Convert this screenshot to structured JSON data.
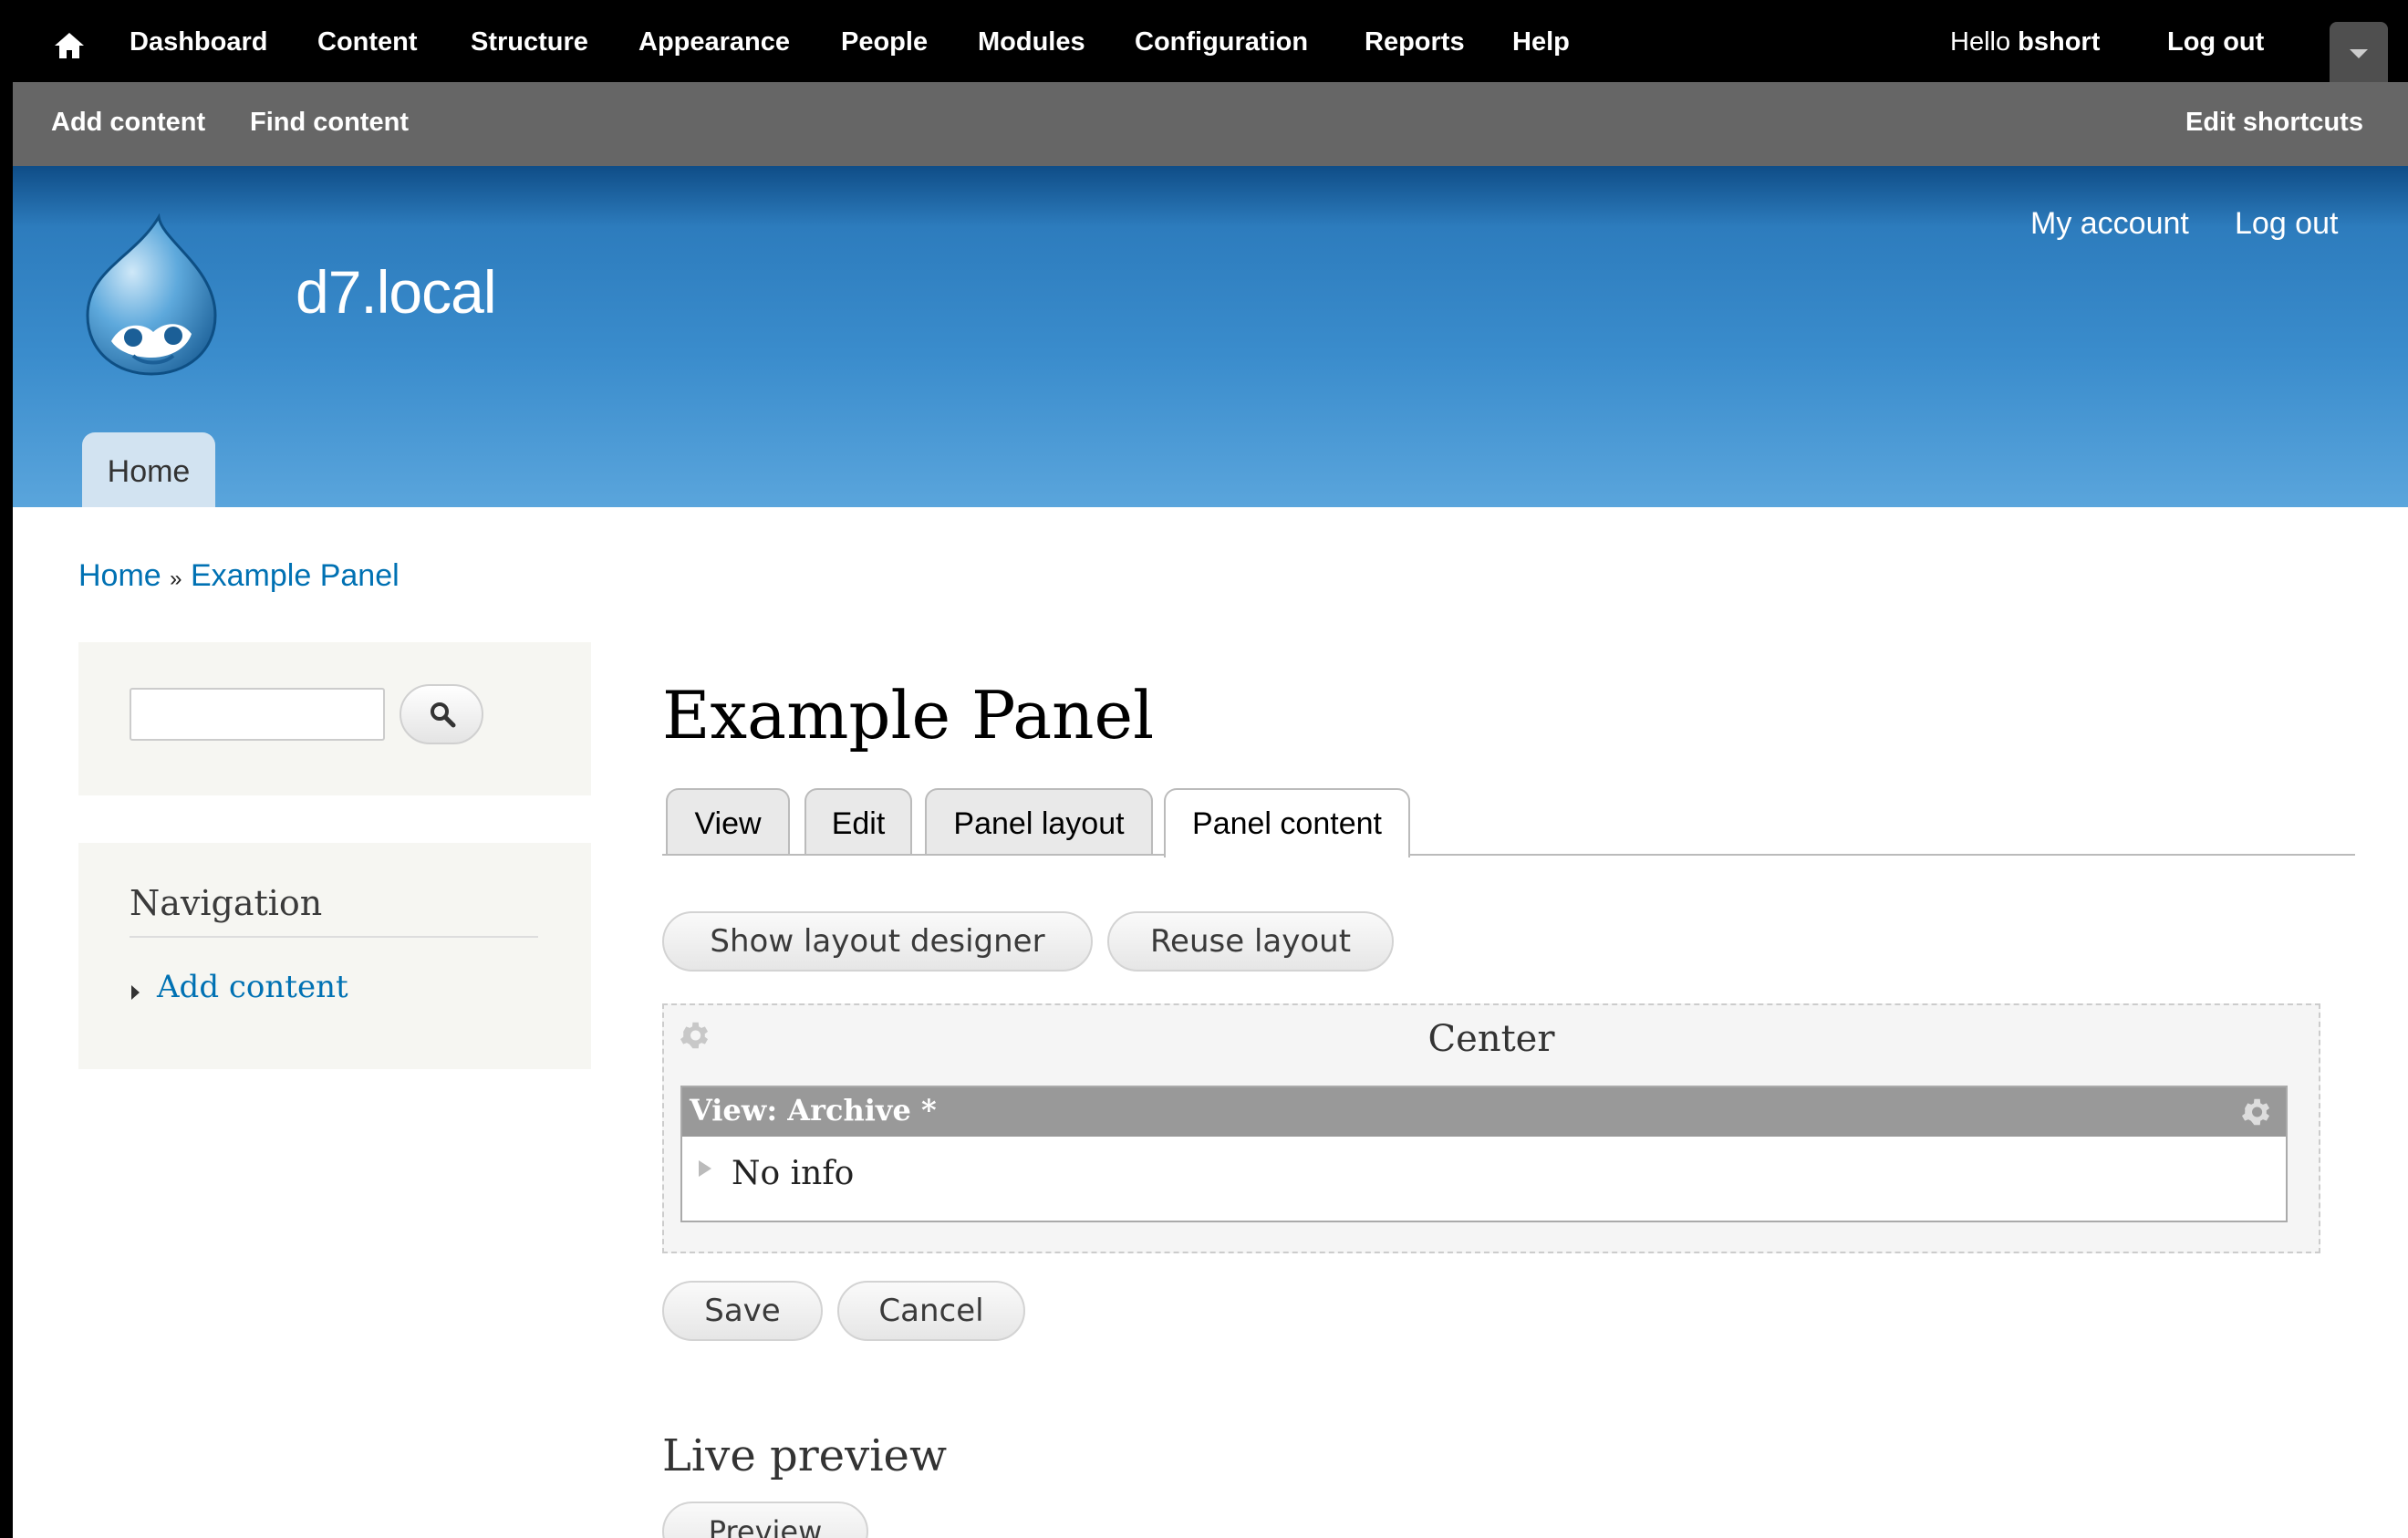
{
  "toolbar": {
    "menu": [
      "Dashboard",
      "Content",
      "Structure",
      "Appearance",
      "People",
      "Modules",
      "Configuration",
      "Reports",
      "Help"
    ],
    "greeting": "Hello",
    "username": "bshort",
    "logout": "Log out"
  },
  "shortcuts": {
    "add_content": "Add content",
    "find_content": "Find content",
    "edit_shortcuts": "Edit shortcuts"
  },
  "header": {
    "site_name": "d7.local",
    "my_account": "My account",
    "logout": "Log out",
    "home_tab": "Home"
  },
  "breadcrumb": {
    "home": "Home",
    "separator": "»",
    "current": "Example Panel"
  },
  "sidebar": {
    "search_value": "",
    "navigation_title": "Navigation",
    "navigation_items": [
      "Add content"
    ]
  },
  "main": {
    "title": "Example Panel",
    "tabs": [
      "View",
      "Edit",
      "Panel layout",
      "Panel content"
    ],
    "active_tab": "Panel content",
    "show_layout_designer": "Show layout designer",
    "reuse_layout": "Reuse layout",
    "region_title": "Center",
    "pane_title": "View: Archive *",
    "pane_info": "No info",
    "save": "Save",
    "cancel": "Cancel",
    "live_preview_title": "Live preview",
    "preview_button": "Preview"
  },
  "colors": {
    "toolbar_bg": "#000000",
    "shortcuts_bg": "#666666",
    "header_blue": "#3a8ccc",
    "link": "#0071b3",
    "pane_bar": "#999999"
  },
  "icons": {
    "home": "home-icon",
    "search": "search-icon",
    "region_settings": "gear-icon",
    "pane_settings": "gear-icon",
    "drawer": "chevron-down-icon",
    "logo": "drupal-logo"
  }
}
